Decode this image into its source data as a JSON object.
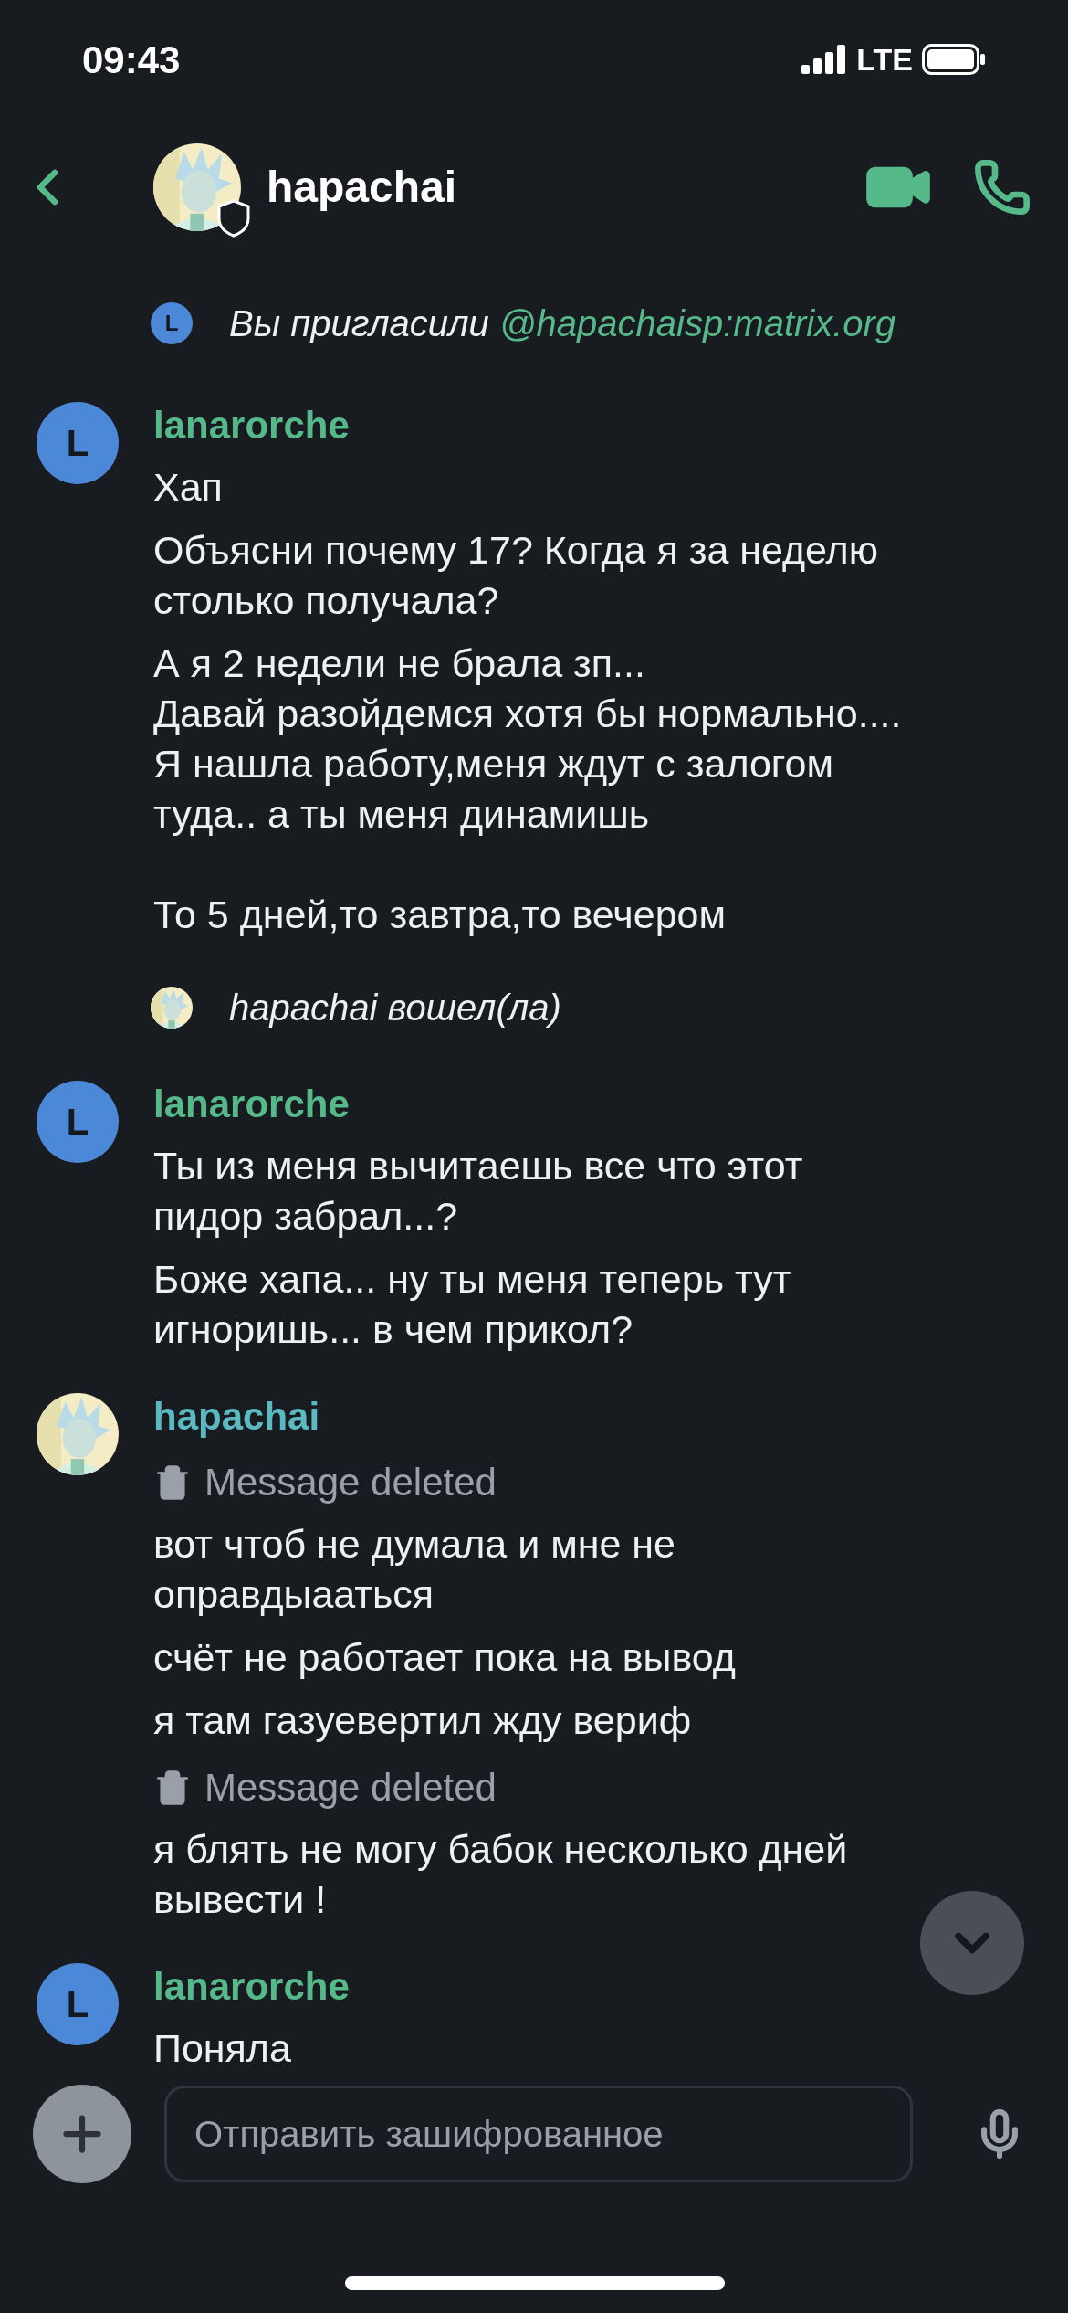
{
  "status_bar": {
    "time": "09:43",
    "network": "LTE"
  },
  "header": {
    "name": "hapachai",
    "verified": true
  },
  "timeline": [
    {
      "kind": "membership",
      "initial": "L",
      "text": "Вы пригласили",
      "link": "@hapachaisp:matrix.org"
    },
    {
      "kind": "group",
      "sender": "lanarorche",
      "avatar": {
        "kind": "letter",
        "initial": "L"
      },
      "color": "#55b98a",
      "messages": [
        {
          "kind": "text",
          "text": "Хап"
        },
        {
          "kind": "text",
          "text": "Объясни почему 17? Когда я за неделю столько получала?"
        },
        {
          "kind": "text",
          "text": "А я 2 недели не брала зп...\nДавай разойдемся хотя бы нормально....\nЯ нашла работу,меня ждут с залогом туда.. а ты меня динамишь\n\nТо 5 дней,то завтра,то вечером"
        }
      ]
    },
    {
      "kind": "presence",
      "text": "hapachai вошел(ла)"
    },
    {
      "kind": "group",
      "sender": "lanarorche",
      "avatar": {
        "kind": "letter",
        "initial": "L"
      },
      "color": "#55b98a",
      "messages": [
        {
          "kind": "text",
          "text": "Ты из меня вычитаешь все что этот пидор забрал...?"
        },
        {
          "kind": "text",
          "text": "Боже хапа... ну ты меня теперь тут игноришь... в чем прикол?"
        }
      ]
    },
    {
      "kind": "group",
      "sender": "hapachai",
      "color": "#5bb9c1",
      "messages": [
        {
          "kind": "deleted",
          "text": "Message deleted"
        },
        {
          "kind": "text",
          "text": "вот чтоб не думала и мне не оправдыааться"
        },
        {
          "kind": "text",
          "text": "счёт не работает пока на вывод"
        },
        {
          "kind": "text",
          "text": "я там газуевертил жду вериф"
        },
        {
          "kind": "deleted",
          "text": "Message deleted"
        },
        {
          "kind": "text",
          "text": "я блять не могу бабок несколько дней вывести !"
        }
      ]
    },
    {
      "kind": "group",
      "sender": "lanarorche",
      "avatar": {
        "kind": "letter",
        "initial": "L"
      },
      "color": "#55b98a",
      "messages": [
        {
          "kind": "text",
          "text": "Поняла"
        }
      ]
    }
  ],
  "composer": {
    "placeholder": "Отправить зашифрованное"
  }
}
